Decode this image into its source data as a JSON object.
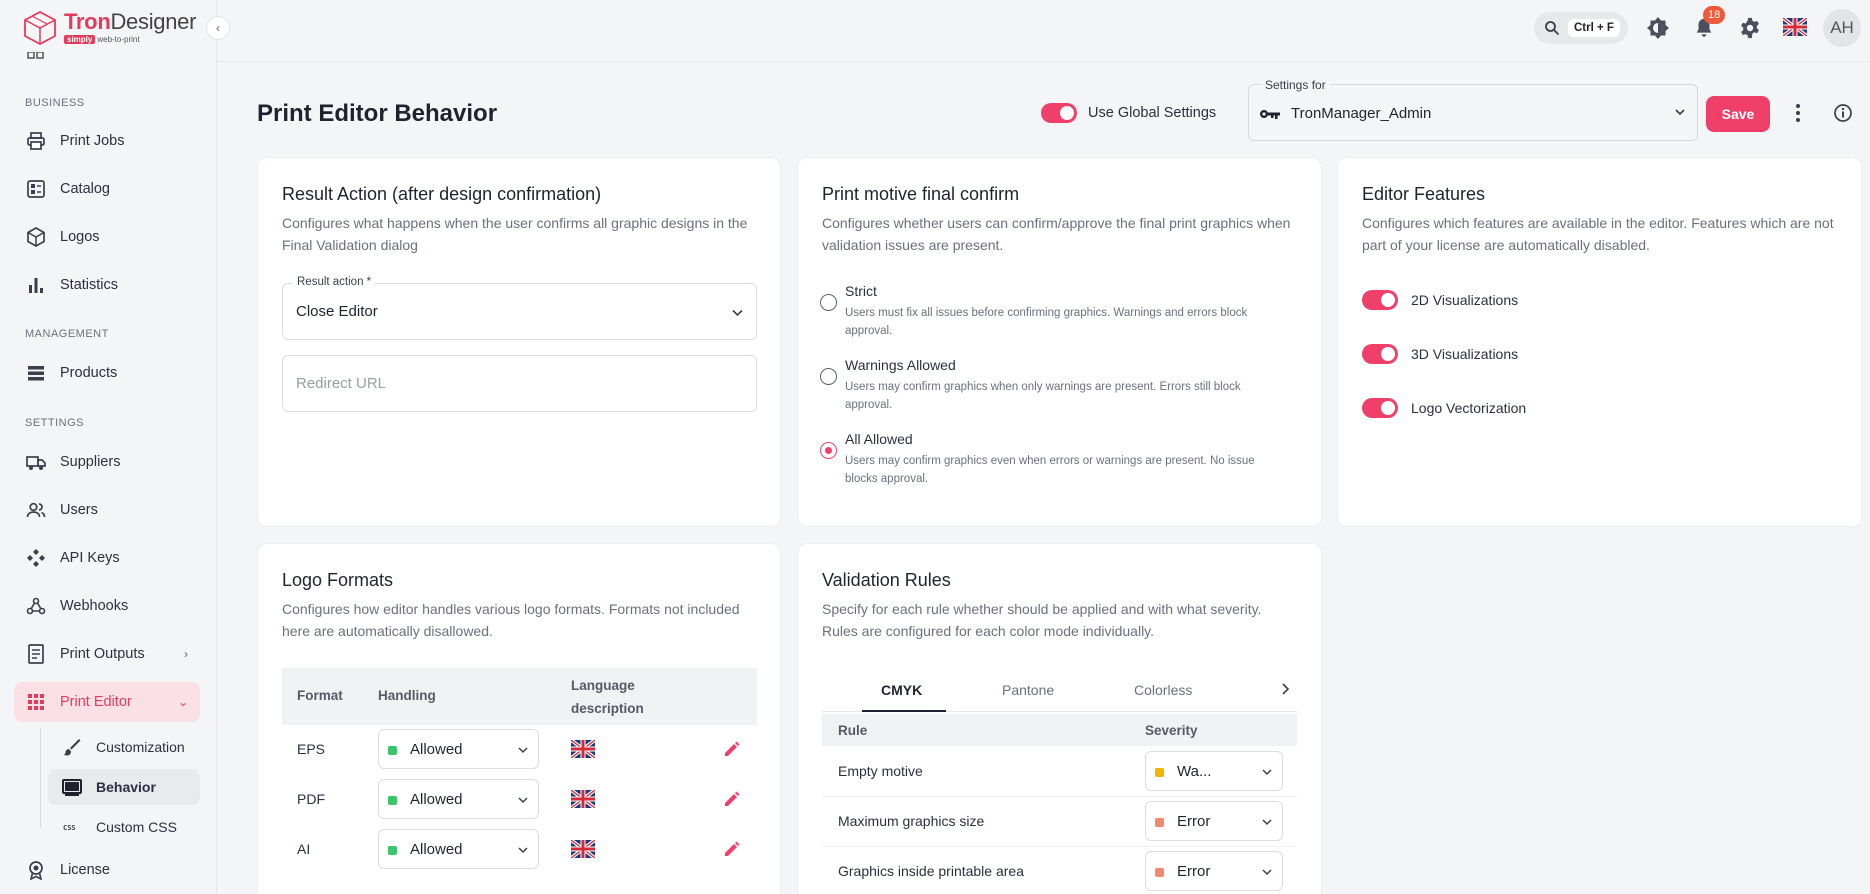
{
  "brand": {
    "name_a": "Tron",
    "name_b": "Designer",
    "sub_tag": "simply",
    "sub_text": "web-to-print"
  },
  "sidebar": {
    "sections": {
      "business": "BUSINESS",
      "management": "MANAGEMENT",
      "settings": "SETTINGS"
    },
    "items": {
      "print_jobs": "Print Jobs",
      "catalog": "Catalog",
      "logos": "Logos",
      "statistics": "Statistics",
      "products": "Products",
      "suppliers": "Suppliers",
      "users": "Users",
      "api_keys": "API Keys",
      "webhooks": "Webhooks",
      "print_outputs": "Print Outputs",
      "print_editor": "Print Editor",
      "customization": "Customization",
      "behavior": "Behavior",
      "custom_css": "Custom CSS",
      "license": "License"
    }
  },
  "topbar": {
    "shortcut": "Ctrl + F",
    "notifications": "18",
    "avatar": "AH"
  },
  "header": {
    "title": "Print Editor Behavior",
    "global_label": "Use Global Settings",
    "settings_for_label": "Settings for",
    "settings_for_value": "TronManager_Admin",
    "save_label": "Save"
  },
  "result_action": {
    "title": "Result Action (after design confirmation)",
    "desc": "Configures what happens when the user confirms all graphic designs in the Final Validation dialog",
    "field_label": "Result action *",
    "field_value": "Close Editor",
    "redirect_placeholder": "Redirect URL"
  },
  "final_confirm": {
    "title": "Print motive final confirm",
    "desc": "Configures whether users can confirm/approve the final print graphics when validation issues are present.",
    "options": [
      {
        "title": "Strict",
        "desc": "Users must fix all issues before confirming graphics. Warnings and errors block approval."
      },
      {
        "title": "Warnings Allowed",
        "desc": "Users may confirm graphics when only warnings are present. Errors still block approval."
      },
      {
        "title": "All Allowed",
        "desc": "Users may confirm graphics even when errors or warnings are present. No issue blocks approval."
      }
    ],
    "selected_index": 2
  },
  "editor_features": {
    "title": "Editor Features",
    "desc": "Configures which features are available in the editor. Features which are not part of your license are automatically disabled.",
    "features": [
      "2D Visualizations",
      "3D Visualizations",
      "Logo Vectorization"
    ]
  },
  "logo_formats": {
    "title": "Logo Formats",
    "desc": "Configures how editor handles various logo formats. Formats not included here are automatically disallowed.",
    "headers": {
      "format": "Format",
      "handling": "Handling",
      "language_1": "Language",
      "language_2": "description"
    },
    "rows": [
      {
        "format": "EPS",
        "handling": "Allowed"
      },
      {
        "format": "PDF",
        "handling": "Allowed"
      },
      {
        "format": "AI",
        "handling": "Allowed"
      }
    ]
  },
  "validation_rules": {
    "title": "Validation Rules",
    "desc": "Specify for each rule whether should be applied and with what severity. Rules are configured for each color mode individually.",
    "tabs": [
      "CMYK",
      "Pantone",
      "Colorless"
    ],
    "headers": {
      "rule": "Rule",
      "severity": "Severity"
    },
    "rows": [
      {
        "rule": "Empty motive",
        "severity": "Wa...",
        "color": "#f5b400"
      },
      {
        "rule": "Maximum graphics size",
        "severity": "Error",
        "color": "#f08a6c"
      },
      {
        "rule": "Graphics inside printable area",
        "severity": "Error",
        "color": "#f08a6c"
      }
    ]
  },
  "colors": {
    "accent": "#f0406a",
    "allowed": "#3cc46a"
  }
}
